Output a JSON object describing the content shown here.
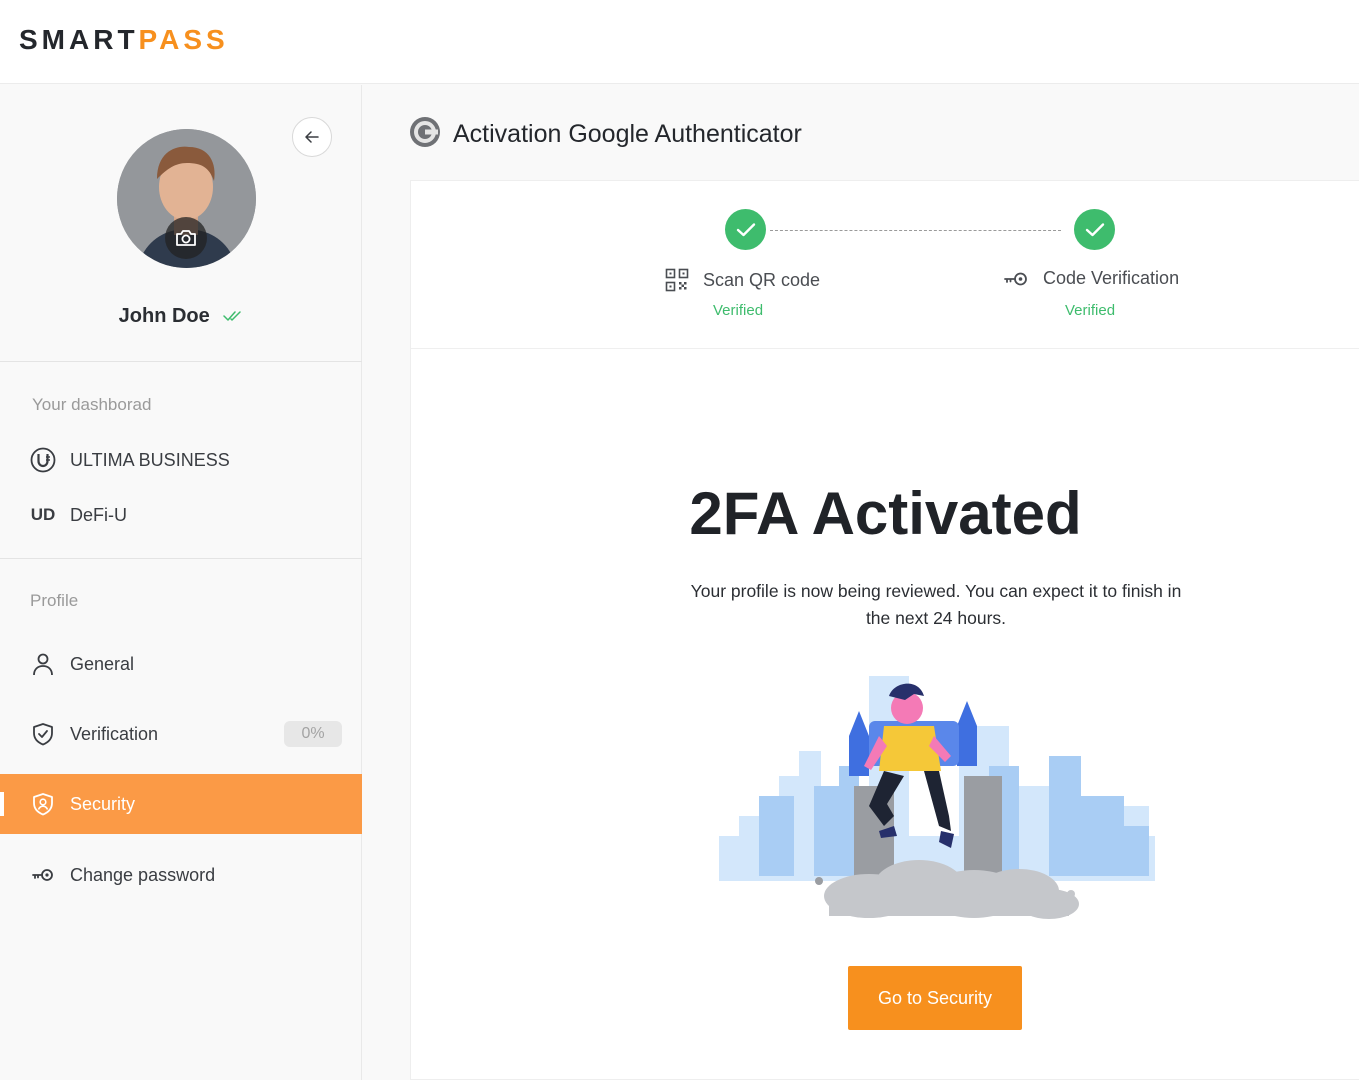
{
  "brand": {
    "part1": "SMART",
    "part2": "PASS"
  },
  "user": {
    "name": "John Doe"
  },
  "sidebar": {
    "dashboard_label": "Your dashborad",
    "dashboard_items": [
      {
        "label": "ULTIMA BUSINESS",
        "icon": "ultima-icon"
      },
      {
        "label": "DeFi-U",
        "icon": "ud-icon",
        "icon_text": "UD"
      }
    ],
    "profile_label": "Profile",
    "profile_items": [
      {
        "label": "General",
        "icon": "user-icon"
      },
      {
        "label": "Verification",
        "icon": "shield-icon",
        "badge": "0%"
      },
      {
        "label": "Security",
        "icon": "shield-user-icon",
        "active": true
      },
      {
        "label": "Change password",
        "icon": "key-icon"
      }
    ]
  },
  "page": {
    "title": "Activation Google Authenticator"
  },
  "steps": [
    {
      "label": "Scan QR code",
      "status": "Verified",
      "icon": "qr-code-icon"
    },
    {
      "label": "Code Verification",
      "status": "Verified",
      "icon": "key-icon"
    }
  ],
  "result": {
    "title": "2FA Activated",
    "description": "Your profile is now being reviewed. You can expect it to finish in the next 24 hours.",
    "button_label": "Go to Security"
  },
  "colors": {
    "accent": "#f7901e",
    "active_nav": "#fb9a46",
    "success": "#3ebc6d"
  }
}
